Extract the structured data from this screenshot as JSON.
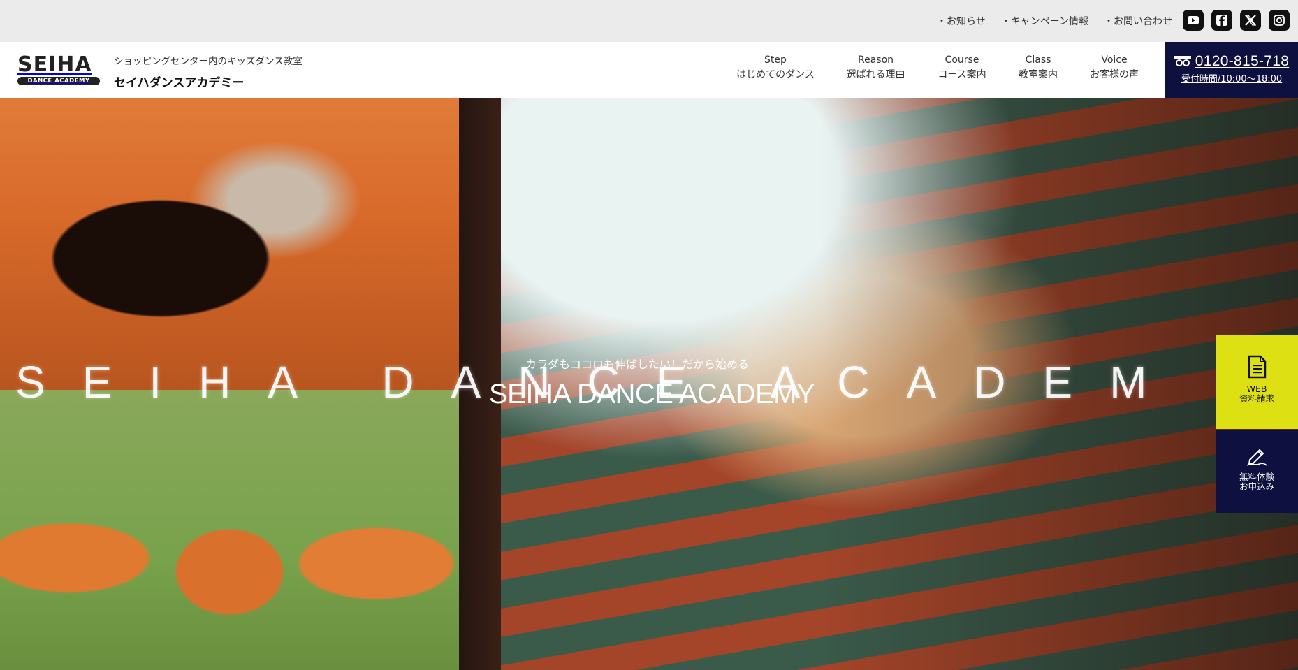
{
  "utility": {
    "links": [
      "・お知らせ",
      "・キャンペーン情報",
      "・お問い合わせ"
    ]
  },
  "social": [
    {
      "name": "youtube-icon"
    },
    {
      "name": "facebook-icon"
    },
    {
      "name": "x-icon"
    },
    {
      "name": "instagram-icon"
    }
  ],
  "header": {
    "logo_main": "SEIHA",
    "logo_sub": "DANCE ACADEMY",
    "tagline": "ショッピングセンター内のキッズダンス教室",
    "brand_ja": "セイハダンスアカデミー"
  },
  "nav": [
    {
      "en": "Step",
      "ja": "はじめてのダンス"
    },
    {
      "en": "Reason",
      "ja": "選ばれる理由"
    },
    {
      "en": "Course",
      "ja": "コース案内"
    },
    {
      "en": "Class",
      "ja": "教室案内"
    },
    {
      "en": "Voice",
      "ja": "お客様の声"
    }
  ],
  "phone": {
    "number": "0120-815-718",
    "hours": "受付時間/10:00～18:00"
  },
  "hero": {
    "big_word": "SEIHA DANCE ACADEM",
    "subtitle": "カラダもココロも伸ばしたい！だから始める",
    "title": "SEIHA DANCE ACADEMY"
  },
  "cta": {
    "web_l1": "WEB",
    "web_l2": "資料請求",
    "trial_l1": "無料体験",
    "trial_l2": "お申込み"
  },
  "colors": {
    "navy": "#0e1040",
    "lime": "#dde012",
    "topbar": "#ebebeb"
  }
}
